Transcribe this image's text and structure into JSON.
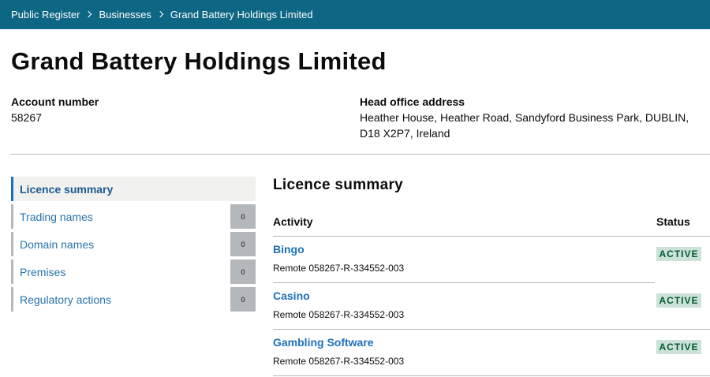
{
  "breadcrumb": [
    "Public Register",
    "Businesses",
    "Grand Battery Holdings Limited"
  ],
  "page_title": "Grand Battery Holdings Limited",
  "account": {
    "label": "Account number",
    "value": "58267"
  },
  "head_office": {
    "label": "Head office address",
    "value": "Heather House, Heather Road, Sandyford Business Park, DUBLIN, D18 X2P7, Ireland"
  },
  "sidenav": [
    {
      "label": "Licence summary",
      "active": true
    },
    {
      "label": "Trading names",
      "count": "0"
    },
    {
      "label": "Domain names",
      "count": "0"
    },
    {
      "label": "Premises",
      "count": "0"
    },
    {
      "label": "Regulatory actions",
      "count": "0"
    }
  ],
  "licence": {
    "title": "Licence summary",
    "columns": {
      "activity": "Activity",
      "status": "Status"
    },
    "rows": [
      {
        "activity": "Bingo",
        "reference": "Remote 058267-R-334552-003",
        "status": "ACTIVE"
      },
      {
        "activity": "Casino",
        "reference": "Remote 058267-R-334552-003",
        "status": "ACTIVE"
      },
      {
        "activity": "Gambling Software",
        "reference": "Remote 058267-R-334552-003",
        "status": "ACTIVE"
      }
    ]
  },
  "colors": {
    "header_bg": "#0d6684",
    "link": "#1d70b8",
    "badge_bg": "#cce2d8",
    "badge_text": "#005a30"
  }
}
